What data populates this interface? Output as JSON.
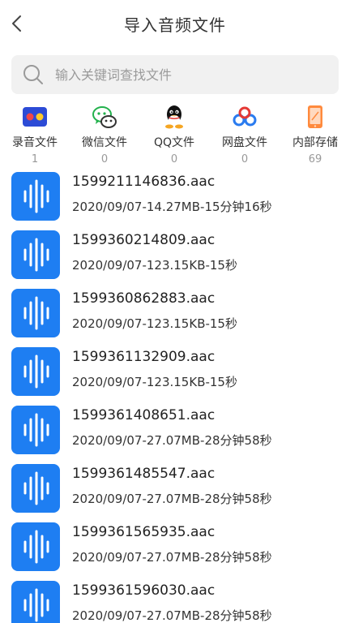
{
  "header": {
    "title": "导入音频文件",
    "back_icon": "chevron-left-icon"
  },
  "search": {
    "placeholder": "输入关键词查找文件",
    "value": ""
  },
  "sources": [
    {
      "label": "录音文件",
      "count": "1",
      "icon": "recorder-icon"
    },
    {
      "label": "微信文件",
      "count": "0",
      "icon": "wechat-icon"
    },
    {
      "label": "QQ文件",
      "count": "0",
      "icon": "qq-icon"
    },
    {
      "label": "网盘文件",
      "count": "0",
      "icon": "cloud-drive-icon"
    },
    {
      "label": "内部存储",
      "count": "69",
      "icon": "phone-storage-icon"
    }
  ],
  "files": [
    {
      "name": "1599211146836.aac",
      "meta": "2020/09/07-14.27MB-15分钟16秒"
    },
    {
      "name": "1599360214809.aac",
      "meta": "2020/09/07-123.15KB-15秒"
    },
    {
      "name": "1599360862883.aac",
      "meta": "2020/09/07-123.15KB-15秒"
    },
    {
      "name": "1599361132909.aac",
      "meta": "2020/09/07-123.15KB-15秒"
    },
    {
      "name": "1599361408651.aac",
      "meta": "2020/09/07-27.07MB-28分钟58秒"
    },
    {
      "name": "1599361485547.aac",
      "meta": "2020/09/07-27.07MB-28分钟58秒"
    },
    {
      "name": "1599361565935.aac",
      "meta": "2020/09/07-27.07MB-28分钟58秒"
    },
    {
      "name": "1599361596030.aac",
      "meta": "2020/09/07-27.07MB-28分钟58秒"
    }
  ],
  "colors": {
    "accent": "#1e7ef2",
    "search_bg": "#f1f1f1",
    "muted_text": "#999999"
  }
}
